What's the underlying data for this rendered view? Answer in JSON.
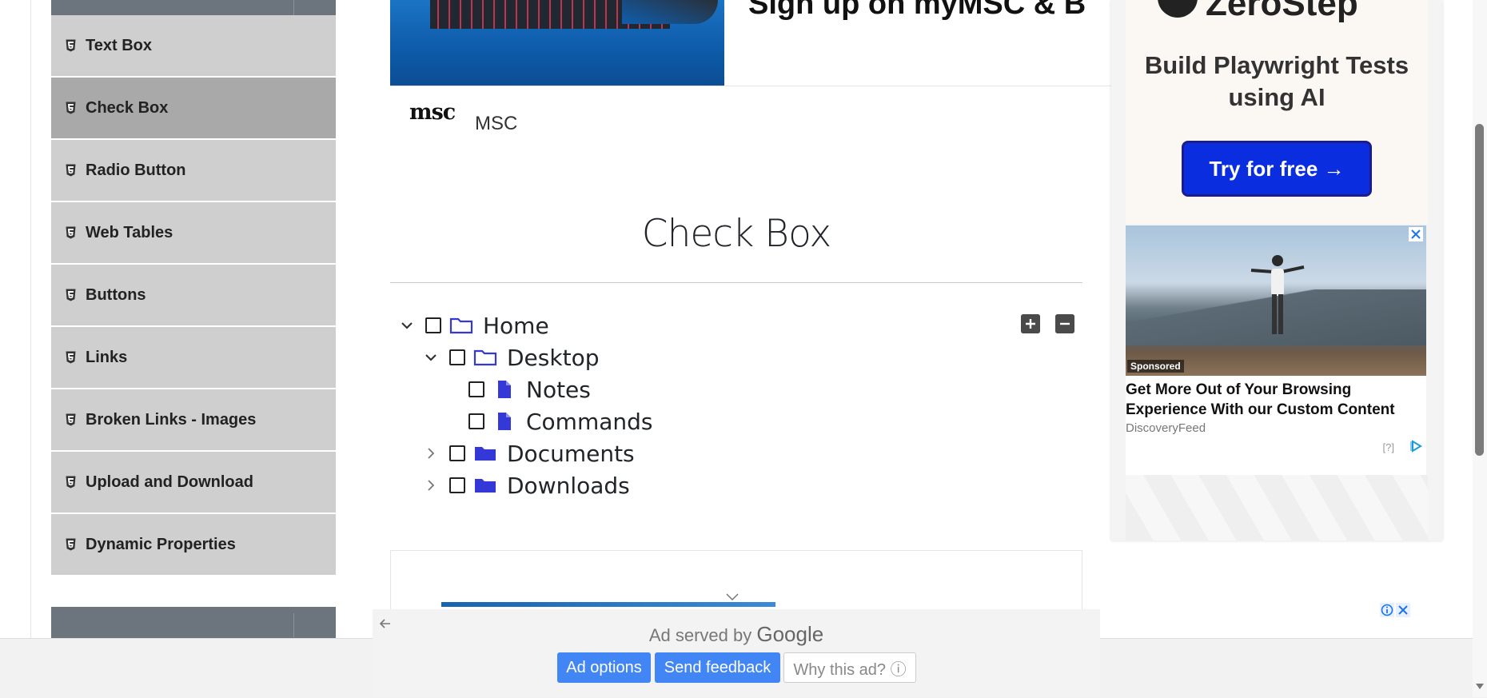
{
  "sidebar": {
    "items": [
      {
        "label": "Text Box",
        "active": false
      },
      {
        "label": "Check Box",
        "active": true
      },
      {
        "label": "Radio Button",
        "active": false
      },
      {
        "label": "Web Tables",
        "active": false
      },
      {
        "label": "Buttons",
        "active": false
      },
      {
        "label": "Links",
        "active": false
      },
      {
        "label": "Broken Links - Images",
        "active": false
      },
      {
        "label": "Upload and Download",
        "active": false
      },
      {
        "label": "Dynamic Properties",
        "active": false
      }
    ],
    "item_icon": "html5-icon"
  },
  "banner_ad": {
    "headline": "Sign up on myMSC & B",
    "advertiser": "MSC",
    "logo_text": "msc"
  },
  "main": {
    "title": "Check Box",
    "expand_all_icon": "plus-square-icon",
    "collapse_all_icon": "minus-square-icon",
    "tree": [
      {
        "label": "Home",
        "level": 0,
        "type": "folder-open",
        "expanded": true,
        "checked": false
      },
      {
        "label": "Desktop",
        "level": 1,
        "type": "folder-open",
        "expanded": true,
        "checked": false
      },
      {
        "label": "Notes",
        "level": 2,
        "type": "file",
        "checked": false
      },
      {
        "label": "Commands",
        "level": 2,
        "type": "file",
        "checked": false
      },
      {
        "label": "Documents",
        "level": 1,
        "type": "folder",
        "expanded": false,
        "checked": false
      },
      {
        "label": "Downloads",
        "level": 1,
        "type": "folder",
        "expanded": false,
        "checked": false
      }
    ]
  },
  "right_ad": {
    "brand": "ZeroStep",
    "headline": "Build Playwright Tests using AI",
    "cta": "Try for free →",
    "sponsored_label": "Sponsored",
    "card_title": "Get More Out of Your Browsing Experience With our Custom Content",
    "card_source": "DiscoveryFeed",
    "help": "[?]"
  },
  "google_ad": {
    "served_by": "Ad served by",
    "google": "Google",
    "ad_options": "Ad options",
    "send_feedback": "Send feedback",
    "why_this_ad": "Why this ad? ⓘ"
  },
  "colors": {
    "sidebar_item": "#cfcfcf",
    "sidebar_active": "#a9a9a9",
    "folder_icon": "#3438d6",
    "google_blue": "#4285f4",
    "cta_blue": "#0b2de0"
  }
}
